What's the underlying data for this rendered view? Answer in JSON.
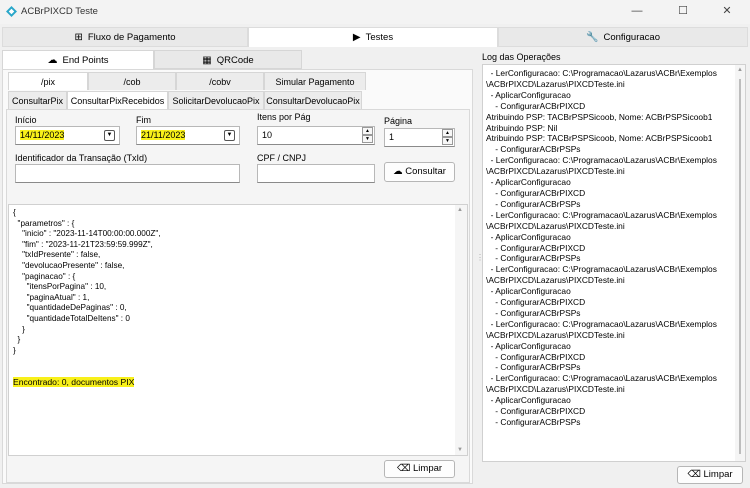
{
  "window": {
    "title": "ACBrPIXCD Teste",
    "minimize": "—",
    "maximize": "☐",
    "close": "✕"
  },
  "top_tabs": [
    {
      "label": "Fluxo de Pagamento",
      "icon": "diagram-icon"
    },
    {
      "label": "Testes",
      "icon": "play-icon"
    },
    {
      "label": "Configuracao",
      "icon": "wrench-icon"
    }
  ],
  "second_tabs": [
    {
      "label": "End Points",
      "icon": "cloud-icon"
    },
    {
      "label": "QRCode",
      "icon": "qrcode-icon"
    }
  ],
  "endpoint_tabs": [
    "/pix",
    "/cob",
    "/cobv",
    "Simular Pagamento"
  ],
  "pix_tabs": [
    "ConsultarPix",
    "ConsultarPixRecebidos",
    "SolicitarDevolucaoPix",
    "ConsultarDevolucaoPix"
  ],
  "form": {
    "inicio_label": "Início",
    "inicio_value": "14/11/2023",
    "fim_label": "Fim",
    "fim_value": "21/11/2023",
    "itens_label": "Itens por Pág",
    "itens_value": "10",
    "pagina_label": "Página",
    "pagina_value": "1",
    "txid_label": "Identificador da Transação (TxId)",
    "txid_value": "",
    "cpf_label": "CPF / CNPJ",
    "cpf_value": "",
    "consultar_label": "Consultar"
  },
  "result": {
    "json_text": "{\n  \"parametros\" : {\n    \"inicio\" : \"2023-11-14T00:00:00.000Z\",\n    \"fim\" : \"2023-11-21T23:59:59.999Z\",\n    \"txIdPresente\" : false,\n    \"devolucaoPresente\" : false,\n    \"paginacao\" : {\n      \"itensPorPagina\" : 10,\n      \"paginaAtual\" : 1,\n      \"quantidadeDePaginas\" : 0,\n      \"quantidadeTotalDeItens\" : 0\n    }\n  }\n}",
    "found_text": "Encontrado: 0, documentos PIX",
    "limpar_label": "Limpar"
  },
  "log": {
    "title": "Log das Operações",
    "lines": [
      "  - LerConfiguracao: C:\\Programacao\\Lazarus\\ACBr\\Exemplos",
      "\\ACBrPIXCD\\Lazarus\\PIXCDTeste.ini",
      "  - AplicarConfiguracao",
      "    - ConfigurarACBrPIXCD",
      "Atribuindo PSP: TACBrPSPSicoob, Nome: ACBrPSPSicoob1",
      "Atribuindo PSP: Nil",
      "Atribuindo PSP: TACBrPSPSicoob, Nome: ACBrPSPSicoob1",
      "    - ConfigurarACBrPSPs",
      "  - LerConfiguracao: C:\\Programacao\\Lazarus\\ACBr\\Exemplos",
      "\\ACBrPIXCD\\Lazarus\\PIXCDTeste.ini",
      "  - AplicarConfiguracao",
      "    - ConfigurarACBrPIXCD",
      "    - ConfigurarACBrPSPs",
      "  - LerConfiguracao: C:\\Programacao\\Lazarus\\ACBr\\Exemplos",
      "\\ACBrPIXCD\\Lazarus\\PIXCDTeste.ini",
      "  - AplicarConfiguracao",
      "    - ConfigurarACBrPIXCD",
      "    - ConfigurarACBrPSPs",
      "  - LerConfiguracao: C:\\Programacao\\Lazarus\\ACBr\\Exemplos",
      "\\ACBrPIXCD\\Lazarus\\PIXCDTeste.ini",
      "  - AplicarConfiguracao",
      "    - ConfigurarACBrPIXCD",
      "    - ConfigurarACBrPSPs",
      "  - LerConfiguracao: C:\\Programacao\\Lazarus\\ACBr\\Exemplos",
      "\\ACBrPIXCD\\Lazarus\\PIXCDTeste.ini",
      "  - AplicarConfiguracao",
      "    - ConfigurarACBrPIXCD",
      "    - ConfigurarACBrPSPs",
      "  - LerConfiguracao: C:\\Programacao\\Lazarus\\ACBr\\Exemplos",
      "\\ACBrPIXCD\\Lazarus\\PIXCDTeste.ini",
      "  - AplicarConfiguracao",
      "    - ConfigurarACBrPIXCD",
      "    - ConfigurarACBrPSPs"
    ],
    "limpar_label": "Limpar"
  },
  "colors": {
    "highlight": "#f8f01a",
    "accent": "#2aa7c9"
  }
}
